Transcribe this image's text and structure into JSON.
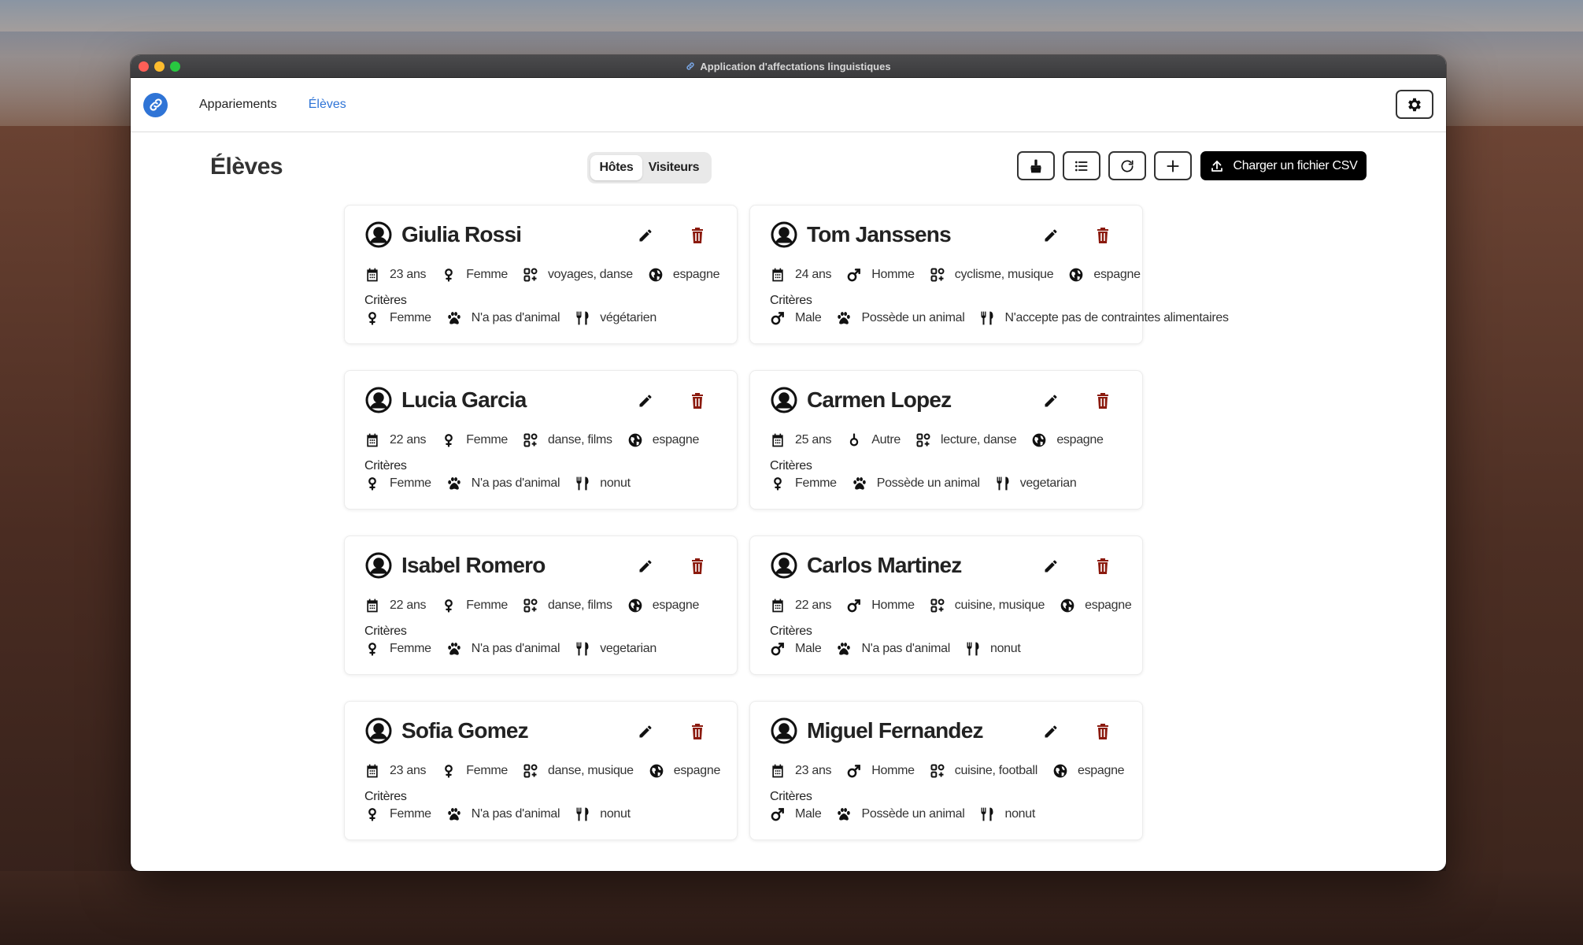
{
  "window": {
    "title": "Application d'affectations linguistiques"
  },
  "nav": {
    "items": [
      {
        "label": "Appariements",
        "active": false
      },
      {
        "label": "Élèves",
        "active": true
      }
    ]
  },
  "page": {
    "title": "Élèves"
  },
  "segmented": {
    "options": [
      {
        "label": "Hôtes",
        "selected": true
      },
      {
        "label": "Visiteurs",
        "selected": false
      }
    ]
  },
  "toolbar": {
    "upload_label": "Charger un fichier CSV"
  },
  "criteria_label": "Critères",
  "colors": {
    "accent": "#2f74d6",
    "delete": "#8b1a0e",
    "primary_button": "#000000"
  },
  "students": [
    {
      "name": "Giulia Rossi",
      "age": "23 ans",
      "gender": "Femme",
      "gender_icon": "venus-icon",
      "interests": "voyages, danse",
      "country": "espagne",
      "criteria": {
        "gender": "Femme",
        "gender_icon": "venus-icon",
        "pet": "N'a pas d'animal",
        "diet": "végétarien"
      }
    },
    {
      "name": "Tom Janssens",
      "age": "24 ans",
      "gender": "Homme",
      "gender_icon": "mars-icon",
      "interests": "cyclisme, musique",
      "country": "espagne",
      "criteria": {
        "gender": "Male",
        "gender_icon": "mars-icon",
        "pet": "Possède un animal",
        "diet": "N'accepte pas de contraintes alimentaires"
      }
    },
    {
      "name": "Lucia Garcia",
      "age": "22 ans",
      "gender": "Femme",
      "gender_icon": "venus-icon",
      "interests": "danse, films",
      "country": "espagne",
      "criteria": {
        "gender": "Femme",
        "gender_icon": "venus-icon",
        "pet": "N'a pas d'animal",
        "diet": "nonut"
      }
    },
    {
      "name": "Carmen Lopez",
      "age": "25 ans",
      "gender": "Autre",
      "gender_icon": "neuter-icon",
      "interests": "lecture, danse",
      "country": "espagne",
      "criteria": {
        "gender": "Femme",
        "gender_icon": "venus-icon",
        "pet": "Possède un animal",
        "diet": "vegetarian"
      }
    },
    {
      "name": "Isabel Romero",
      "age": "22 ans",
      "gender": "Femme",
      "gender_icon": "venus-icon",
      "interests": "danse, films",
      "country": "espagne",
      "criteria": {
        "gender": "Femme",
        "gender_icon": "venus-icon",
        "pet": "N'a pas d'animal",
        "diet": "vegetarian"
      }
    },
    {
      "name": "Carlos Martinez",
      "age": "22 ans",
      "gender": "Homme",
      "gender_icon": "mars-icon",
      "interests": "cuisine, musique",
      "country": "espagne",
      "criteria": {
        "gender": "Male",
        "gender_icon": "mars-icon",
        "pet": "N'a pas d'animal",
        "diet": "nonut"
      }
    },
    {
      "name": "Sofia Gomez",
      "age": "23 ans",
      "gender": "Femme",
      "gender_icon": "venus-icon",
      "interests": "danse, musique",
      "country": "espagne",
      "criteria": {
        "gender": "Femme",
        "gender_icon": "venus-icon",
        "pet": "N'a pas d'animal",
        "diet": "nonut"
      }
    },
    {
      "name": "Miguel Fernandez",
      "age": "23 ans",
      "gender": "Homme",
      "gender_icon": "mars-icon",
      "interests": "cuisine, football",
      "country": "espagne",
      "criteria": {
        "gender": "Male",
        "gender_icon": "mars-icon",
        "pet": "Possède un animal",
        "diet": "nonut"
      }
    }
  ]
}
